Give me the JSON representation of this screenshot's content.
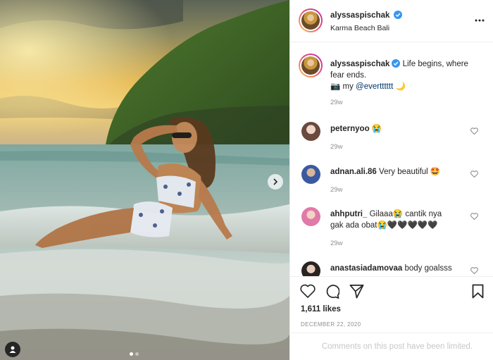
{
  "post": {
    "author": "alyssaspischak",
    "location": "Karma Beach Bali",
    "caption_line1": "Life begins, where",
    "caption_line2": "fear ends.",
    "caption_line3": "📷 my",
    "caption_mention": "@evertttttt",
    "caption_emoji": "🌙",
    "caption_time": "29w",
    "likes": "1,611 likes",
    "date": "DECEMBER 22, 2020",
    "comments_limited": "Comments on this post have been limited."
  },
  "comments": [
    {
      "user": "peternyoo",
      "text": "😭",
      "time": "29w"
    },
    {
      "user": "adnan.ali.86",
      "text": "Very beautiful 🤩",
      "time": "29w"
    },
    {
      "user": "ahhputri_",
      "text": "Gilaaa😭 cantik nya",
      "text2": "gak ada obat😭🖤🖤🖤🖤🖤",
      "time": "29w"
    },
    {
      "user": "anastasiadamovaa",
      "text": "body goalsss",
      "time": ""
    }
  ],
  "icons": {
    "verified": "verified-badge-icon",
    "more": "more-options-icon",
    "like": "heart-icon",
    "comment": "comment-bubble-icon",
    "share": "paper-plane-icon",
    "save": "bookmark-icon",
    "next": "chevron-right-icon",
    "tag": "user-tag-icon"
  },
  "colors": {
    "verified": "#3897f0",
    "muted": "#8e8e8e",
    "text": "#262626"
  },
  "carousel": {
    "count": 2,
    "active": 1
  }
}
